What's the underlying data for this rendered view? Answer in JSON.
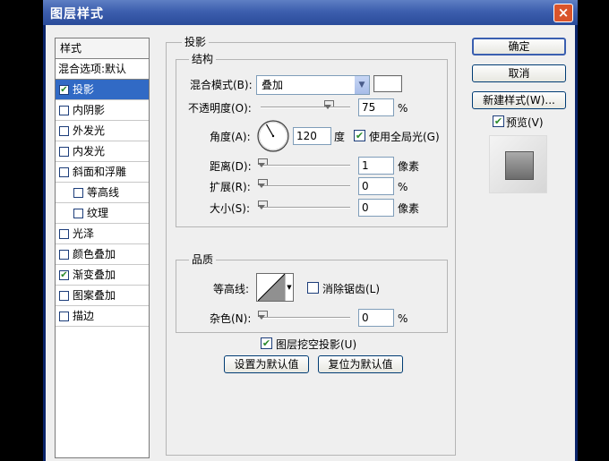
{
  "window": {
    "title": "图层样式",
    "close": "×"
  },
  "style_list": {
    "header": "样式",
    "blend_options": "混合选项:默认",
    "items": [
      {
        "label": "投影",
        "checked": true,
        "selected": true,
        "indent": false
      },
      {
        "label": "内阴影",
        "checked": false,
        "indent": false
      },
      {
        "label": "外发光",
        "checked": false,
        "indent": false
      },
      {
        "label": "内发光",
        "checked": false,
        "indent": false
      },
      {
        "label": "斜面和浮雕",
        "checked": false,
        "indent": false
      },
      {
        "label": "等高线",
        "checked": false,
        "indent": true
      },
      {
        "label": "纹理",
        "checked": false,
        "indent": true
      },
      {
        "label": "光泽",
        "checked": false,
        "indent": false
      },
      {
        "label": "颜色叠加",
        "checked": false,
        "indent": false
      },
      {
        "label": "渐变叠加",
        "checked": true,
        "indent": false
      },
      {
        "label": "图案叠加",
        "checked": false,
        "indent": false
      },
      {
        "label": "描边",
        "checked": false,
        "indent": false
      }
    ]
  },
  "drop_shadow": {
    "title": "投影",
    "structure": {
      "title": "结构",
      "blend_mode_label": "混合模式(B):",
      "blend_mode_value": "叠加",
      "opacity_label": "不透明度(O):",
      "opacity_value": "75",
      "opacity_unit": "%",
      "angle_label": "角度(A):",
      "angle_value": "120",
      "angle_unit": "度",
      "global_light_label": "使用全局光(G)",
      "global_light_checked": true,
      "distance_label": "距离(D):",
      "distance_value": "1",
      "distance_unit": "像素",
      "spread_label": "扩展(R):",
      "spread_value": "0",
      "spread_unit": "%",
      "size_label": "大小(S):",
      "size_value": "0",
      "size_unit": "像素"
    },
    "quality": {
      "title": "品质",
      "contour_label": "等高线:",
      "anti_alias_label": "消除锯齿(L)",
      "anti_alias_checked": false,
      "noise_label": "杂色(N):",
      "noise_value": "0",
      "noise_unit": "%"
    },
    "knockout_label": "图层挖空投影(U)",
    "knockout_checked": true,
    "make_default": "设置为默认值",
    "reset_default": "复位为默认值"
  },
  "buttons": {
    "ok": "确定",
    "cancel": "取消",
    "new_style": "新建样式(W)...",
    "preview_label": "预览(V)",
    "preview_checked": true
  },
  "colors": {
    "shadow_color": "#ffffff",
    "list_selected": "#316ac5"
  }
}
